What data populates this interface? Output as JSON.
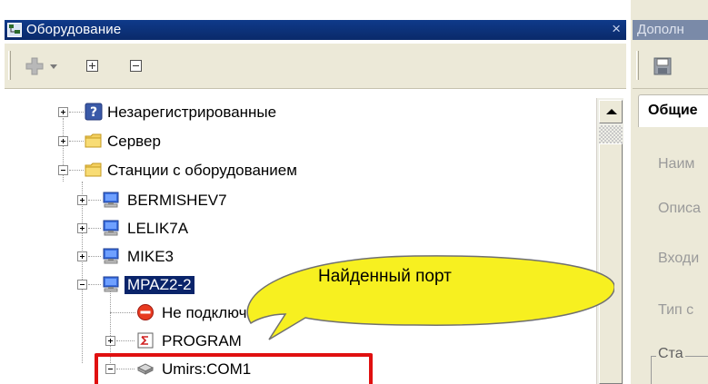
{
  "left_panel": {
    "title": "Оборудование",
    "close_symbol": "×",
    "toolbar": {
      "add_icon": "add-plus-icon",
      "expand_icon": "expand-all-icon",
      "collapse_icon": "collapse-all-icon"
    },
    "tree": [
      {
        "label": "Незарегистрированные",
        "icon": "question-icon",
        "expanded": false
      },
      {
        "label": "Сервер",
        "icon": "folder-icon",
        "expanded": false
      },
      {
        "label": "Станции с оборудованием",
        "icon": "folder-icon",
        "expanded": true
      },
      {
        "label": "BERMISHEV7",
        "icon": "computer-icon",
        "expanded": false
      },
      {
        "label": "LELIK7A",
        "icon": "computer-icon",
        "expanded": false
      },
      {
        "label": "MIKE3",
        "icon": "computer-icon",
        "expanded": false
      },
      {
        "label": "MPAZ2-2",
        "icon": "computer-icon",
        "expanded": true,
        "selected": true
      },
      {
        "label": "Не подключ",
        "icon": "stop-icon"
      },
      {
        "label": "PROGRAM",
        "icon": "program-icon",
        "expanded": false
      },
      {
        "label": "Umirs:COM1",
        "icon": "port-device-icon",
        "expanded": true
      }
    ]
  },
  "callout": {
    "text": "Найденный порт"
  },
  "right_panel": {
    "title": "Дополн",
    "save_icon": "save-icon",
    "tab": "Общие",
    "fields": [
      "Наим",
      "Описа",
      "Входи",
      "Тип с"
    ],
    "group_label": "Ста"
  },
  "colors": {
    "title_active": "#0f3a8a",
    "title_inactive": "#7a8aa8",
    "selection": "#0a246a",
    "highlight_border": "#e01010",
    "callout_fill": "#f7f020"
  }
}
